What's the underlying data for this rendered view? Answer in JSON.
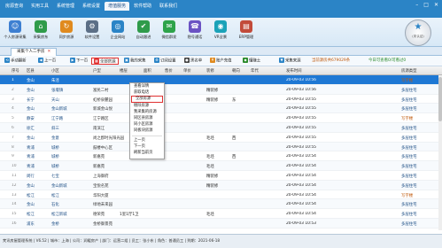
{
  "menubar": [
    "房源查询",
    "实用工具",
    "系统管理",
    "系统设置",
    "增值服务",
    "软件帮助",
    "联系我们"
  ],
  "menubar_active_index": 4,
  "window_controls": [
    "–",
    "□",
    "✕"
  ],
  "toolbar": [
    {
      "label": "个人房源采集",
      "icon": "user-icon",
      "color": "#3d7fd1",
      "glyph": "☺"
    },
    {
      "label": "采集房东",
      "icon": "house-icon",
      "color": "#2f9b4a",
      "glyph": "⌂"
    },
    {
      "label": "同步房源",
      "icon": "sync-icon",
      "color": "#e08a1e",
      "glyph": "↻"
    },
    {
      "label": "软件设置",
      "icon": "gear-icon",
      "color": "#5c6f86",
      "glyph": "⚙"
    },
    {
      "label": "企业网站",
      "icon": "globe-icon",
      "color": "#2b84c6",
      "glyph": "◎"
    },
    {
      "label": "自动跟进",
      "icon": "follow-icon",
      "color": "#2f9b4a",
      "glyph": "✔"
    },
    {
      "label": "微信群发",
      "icon": "chat-icon",
      "color": "#2ea34a",
      "glyph": "✉"
    },
    {
      "label": "隐号通话",
      "icon": "phone-icon",
      "color": "#6b52c3",
      "glyph": "☎"
    },
    {
      "label": "VR全景",
      "icon": "vr-icon",
      "color": "#1aa2b8",
      "glyph": "◉"
    },
    {
      "label": "ERP管理",
      "icon": "erp-icon",
      "color": "#c24b3a",
      "glyph": "▤"
    }
  ],
  "brand": {
    "mark": "★",
    "sub": "(未认证)"
  },
  "tab": {
    "label": "采集个人二手房",
    "close": "✕"
  },
  "actions": [
    {
      "label": "手动翻新",
      "glyph": "⟲",
      "color": "#2b84c6"
    },
    {
      "label": "上一页",
      "glyph": "◀",
      "color": "#2b84c6"
    },
    {
      "label": "下一页",
      "glyph": "▶",
      "color": "#2b84c6"
    },
    {
      "label": "全部房源",
      "glyph": "▦",
      "color": "#e03030"
    },
    {
      "label": "我的采集",
      "glyph": "▣",
      "color": "#2b84c6"
    },
    {
      "label": "订阅设置",
      "glyph": "⚙",
      "color": "#2b84c6"
    },
    {
      "label": "黑名单",
      "glyph": "●",
      "color": "#444"
    },
    {
      "label": "账户充值",
      "glyph": "¥",
      "color": "#e08a1e"
    },
    {
      "label": "懂赚土",
      "glyph": "◆",
      "color": "#2a8a2a"
    },
    {
      "label": "采集来源",
      "glyph": "▼",
      "color": "#2b84c6"
    },
    {
      "label": "当前源房共679029条",
      "glyph": "",
      "color": ""
    },
    {
      "label": "今日可查看0/可看过0",
      "glyph": "",
      "color": ""
    }
  ],
  "columns": [
    "序号",
    "区县",
    "小区",
    "户型",
    "楼层",
    "面积",
    "售价",
    "单价",
    "装修",
    "朝向",
    "年代",
    "发布时间",
    "房源类型"
  ],
  "rows": [
    [
      "1",
      "金山",
      "朱泾",
      "",
      "",
      "",
      "",
      "",
      "",
      "",
      "",
      "20-09-03 10:56",
      "写字楼"
    ],
    [
      "2",
      "金山",
      "张堰镇",
      "富民二村",
      "",
      "",
      "",
      "",
      "精装修",
      "",
      "",
      "20-09-03 10:56",
      "多层住宅"
    ],
    [
      "3",
      "长宁",
      "天山",
      "虹桥泉麓园",
      "",
      "",
      "",
      "",
      "精装修",
      "东",
      "",
      "20-09-03 10:55",
      "多层住宅"
    ],
    [
      "4",
      "金山",
      "金山新城",
      "新城金山悦",
      "",
      "",
      "",
      "",
      "",
      "",
      "",
      "20-09-03 10:55",
      "多层住宅"
    ],
    [
      "5",
      "静安",
      "江宁路",
      "江宁路区",
      "",
      "",
      "",
      "",
      "",
      "",
      "",
      "20-09-03 10:55",
      "写字楼"
    ],
    [
      "6",
      "徐汇",
      "斜三",
      "南滨江",
      "",
      "",
      "",
      "",
      "",
      "",
      "",
      "20-09-03 10:55",
      "多层住宅"
    ],
    [
      "7",
      "金山",
      "金意",
      "尚之郡时光阳光园",
      "",
      "",
      "",
      "",
      "毛坯",
      "西",
      "",
      "20-09-03 10:55",
      "多层住宅"
    ],
    [
      "8",
      "青浦",
      "城桥",
      "鼓楼中心区",
      "",
      "",
      "",
      "",
      "",
      "",
      "",
      "20-09-03 10:55",
      "多层住宅"
    ],
    [
      "9",
      "青浦",
      "城桥",
      "新嘉苑",
      "",
      "",
      "",
      "",
      "毛坯",
      "西",
      "",
      "20-09-03 10:54",
      "多层住宅"
    ],
    [
      "10",
      "青浦",
      "城桥",
      "新嘉苑",
      "",
      "",
      "",
      "",
      "毛坯",
      "",
      "",
      "20-09-03 10:54",
      "多层住宅"
    ],
    [
      "11",
      "闵行",
      "七宝",
      "上海御府",
      "",
      "",
      "",
      "",
      "精装修",
      "",
      "",
      "20-09-03 10:54",
      "多层住宅"
    ],
    [
      "12",
      "金山",
      "金山新城",
      "宝悦名苑",
      "",
      "",
      "",
      "",
      "精装修",
      "",
      "",
      "20-09-03 10:54",
      "多层住宅"
    ],
    [
      "13",
      "松江",
      "松江",
      "华阳大厦",
      "",
      "",
      "",
      "",
      "",
      "",
      "",
      "20-09-03 10:54",
      "写字楼"
    ],
    [
      "14",
      "金山",
      "石化",
      "绿地未来园",
      "",
      "",
      "",
      "",
      "",
      "",
      "",
      "20-09-03 10:54",
      "多层住宅"
    ],
    [
      "15",
      "松江",
      "松江新城",
      "德荣苑",
      "1室1厅1卫",
      "",
      "",
      "",
      "毛坯",
      "",
      "",
      "20-09-03 10:54",
      "多层住宅"
    ],
    [
      "16",
      "浦东",
      "金桥",
      "金桥御景苑",
      "",
      "",
      "",
      "",
      "",
      "",
      "",
      "20-09-03 10:53",
      "多层住宅"
    ],
    [
      "17",
      "浦东",
      "曹路",
      "金德南苑",
      "3室2厅2卫",
      "",
      "",
      "",
      "精装修",
      "",
      "",
      "20-09-03 10:53",
      "多层住宅"
    ],
    [
      "18",
      "青浦",
      "夏阳",
      "安亭智谷公园",
      "",
      "",
      "",
      "",
      "精装修",
      "",
      "",
      "20-09-03 10:53",
      "多层住宅"
    ],
    [
      "19",
      "浦东",
      "三林",
      "阳光湖苑",
      "",
      "",
      "",
      "",
      "",
      "",
      "",
      "20-09-03 10:53",
      "多层住宅"
    ]
  ],
  "selected_row_index": 0,
  "context_menu": [
    "查看详情",
    "获取电话",
    "全部房源",
    "剔除房源",
    "我采集的房源",
    "同区县房源",
    "同小区房源",
    "同板块房源",
    "上一页",
    "下一页",
    "刷新当前页"
  ],
  "context_menu_boxed_index": 2,
  "status": "梵讯房屋管理系统 | V6.52 | 城市：上海 | 公司：润暖房产 | 部门：运营二组 | 员工：张小东 | 角色：普通员工 | 到期：2021-06-18"
}
